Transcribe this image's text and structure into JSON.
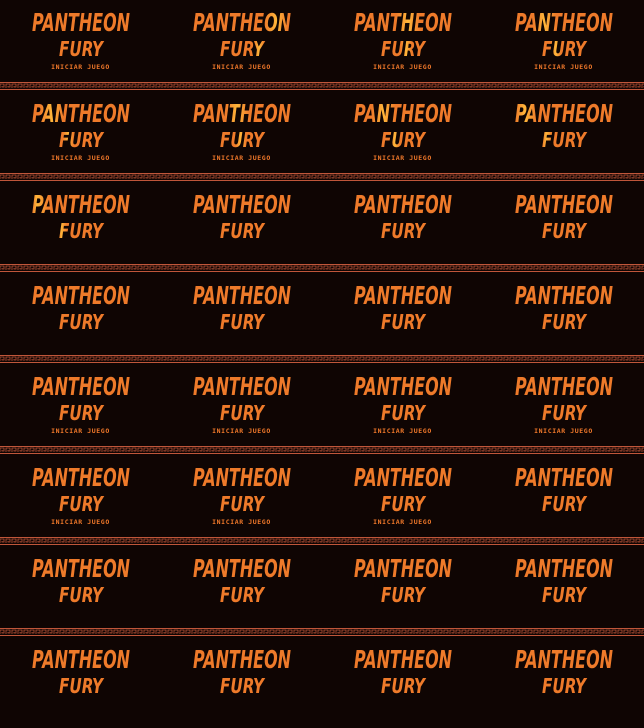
{
  "game": {
    "title_line1": "PANTHEON",
    "title_line2": "FURY",
    "start_label": "INICIAR JUEGO"
  },
  "colors": {
    "background": "#0f0503",
    "logo_orange": "#ee7a2a",
    "logo_highlight": "#ffb63a",
    "border": "#c0563a"
  },
  "sprite_sheet": {
    "rows": [
      {
        "frames": [
          {
            "start_visible": true
          },
          {
            "start_visible": true
          },
          {
            "start_visible": true
          },
          {
            "start_visible": true
          }
        ]
      },
      {
        "frames": [
          {
            "start_visible": true
          },
          {
            "start_visible": true
          },
          {
            "start_visible": true
          },
          {
            "start_visible": false
          }
        ]
      },
      {
        "frames": [
          {
            "start_visible": false
          },
          {
            "start_visible": false
          },
          {
            "start_visible": false
          },
          {
            "start_visible": false
          }
        ]
      },
      {
        "frames": [
          {
            "start_visible": false
          },
          {
            "start_visible": false
          },
          {
            "start_visible": false
          },
          {
            "start_visible": false
          }
        ]
      },
      {
        "frames": [
          {
            "start_visible": true
          },
          {
            "start_visible": true
          },
          {
            "start_visible": true
          },
          {
            "start_visible": true
          }
        ]
      },
      {
        "frames": [
          {
            "start_visible": true
          },
          {
            "start_visible": true
          },
          {
            "start_visible": true
          },
          {
            "start_visible": false
          }
        ]
      },
      {
        "frames": [
          {
            "start_visible": false
          },
          {
            "start_visible": false
          },
          {
            "start_visible": false
          },
          {
            "start_visible": false
          }
        ]
      },
      {
        "frames": [
          {
            "start_visible": false
          },
          {
            "start_visible": false
          },
          {
            "start_visible": false
          },
          {
            "start_visible": false
          }
        ]
      }
    ]
  }
}
